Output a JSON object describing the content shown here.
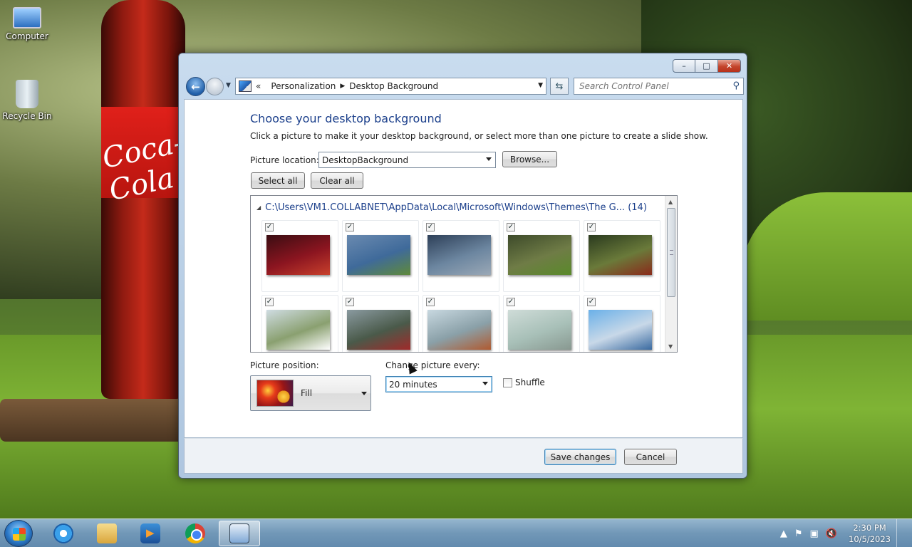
{
  "desktop": {
    "icons": [
      {
        "label": "Computer",
        "icon": "computer-icon"
      },
      {
        "label": "Recycle Bin",
        "icon": "recycle-bin-icon"
      }
    ],
    "wallpaper_text": "Coca-Cola"
  },
  "window": {
    "caption_buttons": {
      "minimize": "–",
      "maximize": "□",
      "close": "✕"
    },
    "address": {
      "crumb_prefix": "«",
      "crumbs": [
        "Personalization",
        "Desktop Background"
      ],
      "separator": "▶"
    },
    "search": {
      "placeholder": "Search Control Panel"
    },
    "heading": "Choose your desktop background",
    "subtext": "Click a picture to make it your desktop background, or select more than one picture to create a slide show.",
    "picture_location": {
      "label": "Picture location:",
      "value": "DesktopBackground"
    },
    "browse_label": "Browse...",
    "select_all_label": "Select all",
    "clear_all_label": "Clear all",
    "gallery": {
      "group_header": "C:\\Users\\VM1.COLLABNET\\AppData\\Local\\Microsoft\\Windows\\Themes\\The G... (14)",
      "thumbnails": [
        {
          "checked": true,
          "colors": [
            "#3a0d12",
            "#8c1520",
            "#c8402c"
          ]
        },
        {
          "checked": true,
          "colors": [
            "#6a8ab0",
            "#3f6a9a",
            "#5f8a3a"
          ]
        },
        {
          "checked": true,
          "colors": [
            "#2d3f58",
            "#6c86a0",
            "#9aa8b6"
          ]
        },
        {
          "checked": true,
          "colors": [
            "#3d4a2a",
            "#6f7c46",
            "#5a8a2a"
          ]
        },
        {
          "checked": true,
          "colors": [
            "#2a3a1e",
            "#6a7a3a",
            "#8a2a1a"
          ]
        },
        {
          "checked": true,
          "colors": [
            "#cfdce2",
            "#8aa070",
            "#ffffff"
          ]
        },
        {
          "checked": true,
          "colors": [
            "#8a9aa0",
            "#4a5a4a",
            "#a02a2a"
          ]
        },
        {
          "checked": true,
          "colors": [
            "#c8d8e0",
            "#8aa0a8",
            "#b05a30"
          ]
        },
        {
          "checked": true,
          "colors": [
            "#cfdcd8",
            "#a8c0b8",
            "#889890"
          ]
        },
        {
          "checked": true,
          "colors": [
            "#6ab0e8",
            "#c8d8e8",
            "#3a6aa0"
          ]
        }
      ]
    },
    "picture_position": {
      "label": "Picture position:",
      "value": "Fill"
    },
    "change_every": {
      "label": "Change picture every:",
      "value": "20 minutes"
    },
    "shuffle": {
      "label": "Shuffle",
      "checked": false
    },
    "save_label": "Save changes",
    "cancel_label": "Cancel"
  },
  "taskbar": {
    "items": [
      "start-button",
      "internet-explorer-icon",
      "windows-explorer-icon",
      "windows-media-player-icon",
      "chrome-icon",
      "control-panel-icon"
    ],
    "tray": {
      "time": "2:30 PM",
      "date": "10/5/2023",
      "arrow": "▲",
      "flag": "⚑",
      "network": "▣",
      "volume": "🔇"
    }
  }
}
